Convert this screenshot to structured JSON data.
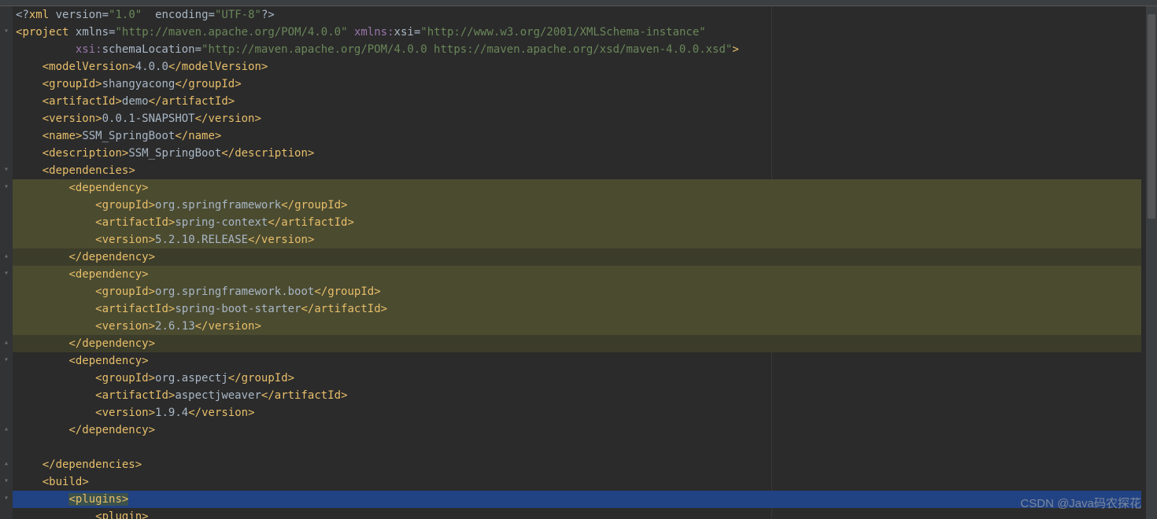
{
  "xml_decl": {
    "version": "1.0",
    "encoding": "UTF-8"
  },
  "project": {
    "xmlns": "http://maven.apache.org/POM/4.0.0",
    "xmlns_xsi": "http://www.w3.org/2001/XMLSchema-instance",
    "schemaLocation": "http://maven.apache.org/POM/4.0.0 https://maven.apache.org/xsd/maven-4.0.0.xsd",
    "modelVersion": "4.0.0",
    "groupId": "shangyacong",
    "artifactId": "demo",
    "version": "0.0.1-SNAPSHOT",
    "name": "SSM_SpringBoot",
    "description": "SSM_SpringBoot"
  },
  "dependencies": [
    {
      "groupId": "org.springframework",
      "artifactId": "spring-context",
      "version": "5.2.10.RELEASE"
    },
    {
      "groupId": "org.springframework.boot",
      "artifactId": "spring-boot-starter",
      "version": "2.6.13"
    },
    {
      "groupId": "org.aspectj",
      "artifactId": "aspectjweaver",
      "version": "1.9.4"
    }
  ],
  "build": {
    "plugins_open": "<plugins>",
    "plugin_open": "<plugin>"
  },
  "watermark": "CSDN @Java码农探花"
}
